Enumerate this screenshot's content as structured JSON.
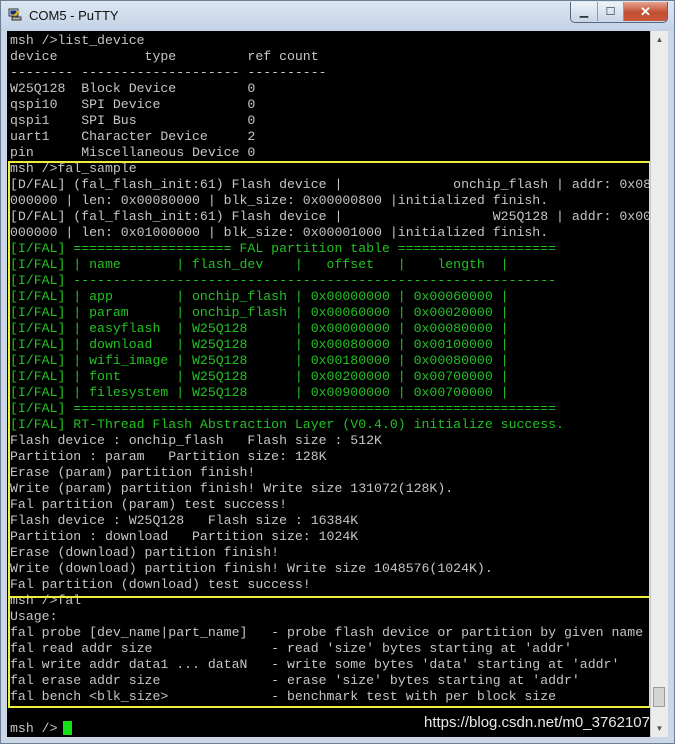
{
  "window": {
    "title": "COM5 - PuTTY",
    "controls": {
      "minimize": "▁",
      "maximize": "☐",
      "close": "✕"
    }
  },
  "terminal": {
    "lines": [
      {
        "text": "msh />list_device",
        "color": "gray"
      },
      {
        "text": "device           type         ref count",
        "color": "gray"
      },
      {
        "text": "-------- -------------------- ----------",
        "color": "gray"
      },
      {
        "text": "W25Q128  Block Device         0",
        "color": "gray"
      },
      {
        "text": "qspi10   SPI Device           0",
        "color": "gray"
      },
      {
        "text": "qspi1    SPI Bus              0",
        "color": "gray"
      },
      {
        "text": "uart1    Character Device     2",
        "color": "gray"
      },
      {
        "text": "pin      Miscellaneous Device 0",
        "color": "gray"
      },
      {
        "text": "msh />fal_sample",
        "color": "gray"
      },
      {
        "text": "[D/FAL] (fal_flash_init:61) Flash device |              onchip_flash | addr: 0x08",
        "color": "gray"
      },
      {
        "text": "000000 | len: 0x00080000 | blk_size: 0x00000800 |initialized finish.",
        "color": "gray"
      },
      {
        "text": "[D/FAL] (fal_flash_init:61) Flash device |                   W25Q128 | addr: 0x00",
        "color": "gray"
      },
      {
        "text": "000000 | len: 0x01000000 | blk_size: 0x00001000 |initialized finish.",
        "color": "gray"
      },
      {
        "text": "[I/FAL] ==================== FAL partition table ====================",
        "color": "green"
      },
      {
        "text": "[I/FAL] | name       | flash_dev    |   offset   |    length  |",
        "color": "green"
      },
      {
        "text": "[I/FAL] -------------------------------------------------------------",
        "color": "green"
      },
      {
        "text": "[I/FAL] | app        | onchip_flash | 0x00000000 | 0x00060000 |",
        "color": "green"
      },
      {
        "text": "[I/FAL] | param      | onchip_flash | 0x00060000 | 0x00020000 |",
        "color": "green"
      },
      {
        "text": "[I/FAL] | easyflash  | W25Q128      | 0x00000000 | 0x00080000 |",
        "color": "green"
      },
      {
        "text": "[I/FAL] | download   | W25Q128      | 0x00080000 | 0x00100000 |",
        "color": "green"
      },
      {
        "text": "[I/FAL] | wifi_image | W25Q128      | 0x00180000 | 0x00080000 |",
        "color": "green"
      },
      {
        "text": "[I/FAL] | font       | W25Q128      | 0x00200000 | 0x00700000 |",
        "color": "green"
      },
      {
        "text": "[I/FAL] | filesystem | W25Q128      | 0x00900000 | 0x00700000 |",
        "color": "green"
      },
      {
        "text": "[I/FAL] =============================================================",
        "color": "green"
      },
      {
        "text": "[I/FAL] RT-Thread Flash Abstraction Layer (V0.4.0) initialize success.",
        "color": "green"
      },
      {
        "text": "Flash device : onchip_flash   Flash size : 512K",
        "color": "gray"
      },
      {
        "text": "Partition : param   Partition size: 128K",
        "color": "gray"
      },
      {
        "text": "Erase (param) partition finish!",
        "color": "gray"
      },
      {
        "text": "Write (param) partition finish! Write size 131072(128K).",
        "color": "gray"
      },
      {
        "text": "Fal partition (param) test success!",
        "color": "gray"
      },
      {
        "text": "Flash device : W25Q128   Flash size : 16384K",
        "color": "gray"
      },
      {
        "text": "Partition : download   Partition size: 1024K",
        "color": "gray"
      },
      {
        "text": "Erase (download) partition finish!",
        "color": "gray"
      },
      {
        "text": "Write (download) partition finish! Write size 1048576(1024K).",
        "color": "gray"
      },
      {
        "text": "Fal partition (download) test success!",
        "color": "gray"
      },
      {
        "text": "msh />fal",
        "color": "gray"
      },
      {
        "text": "Usage:",
        "color": "gray"
      },
      {
        "text": "fal probe [dev_name|part_name]   - probe flash device or partition by given name",
        "color": "gray"
      },
      {
        "text": "fal read addr size               - read 'size' bytes starting at 'addr'",
        "color": "gray"
      },
      {
        "text": "fal write addr data1 ... dataN   - write some bytes 'data' starting at 'addr'",
        "color": "gray"
      },
      {
        "text": "fal erase addr size              - erase 'size' bytes starting at 'addr'",
        "color": "gray"
      },
      {
        "text": "fal bench <blk_size>             - benchmark test with per block size",
        "color": "gray"
      },
      {
        "text": "",
        "color": "gray"
      },
      {
        "text": "msh />",
        "color": "gray"
      }
    ],
    "colors": {
      "gray": "#c6c6c6",
      "green": "#22c222",
      "highlight": "#f0ee3c",
      "cursor": "#14e014"
    }
  },
  "watermark": "https://blog.csdn.net/m0_3762107",
  "scrollbar": {
    "up": "▲",
    "down": "▼"
  }
}
